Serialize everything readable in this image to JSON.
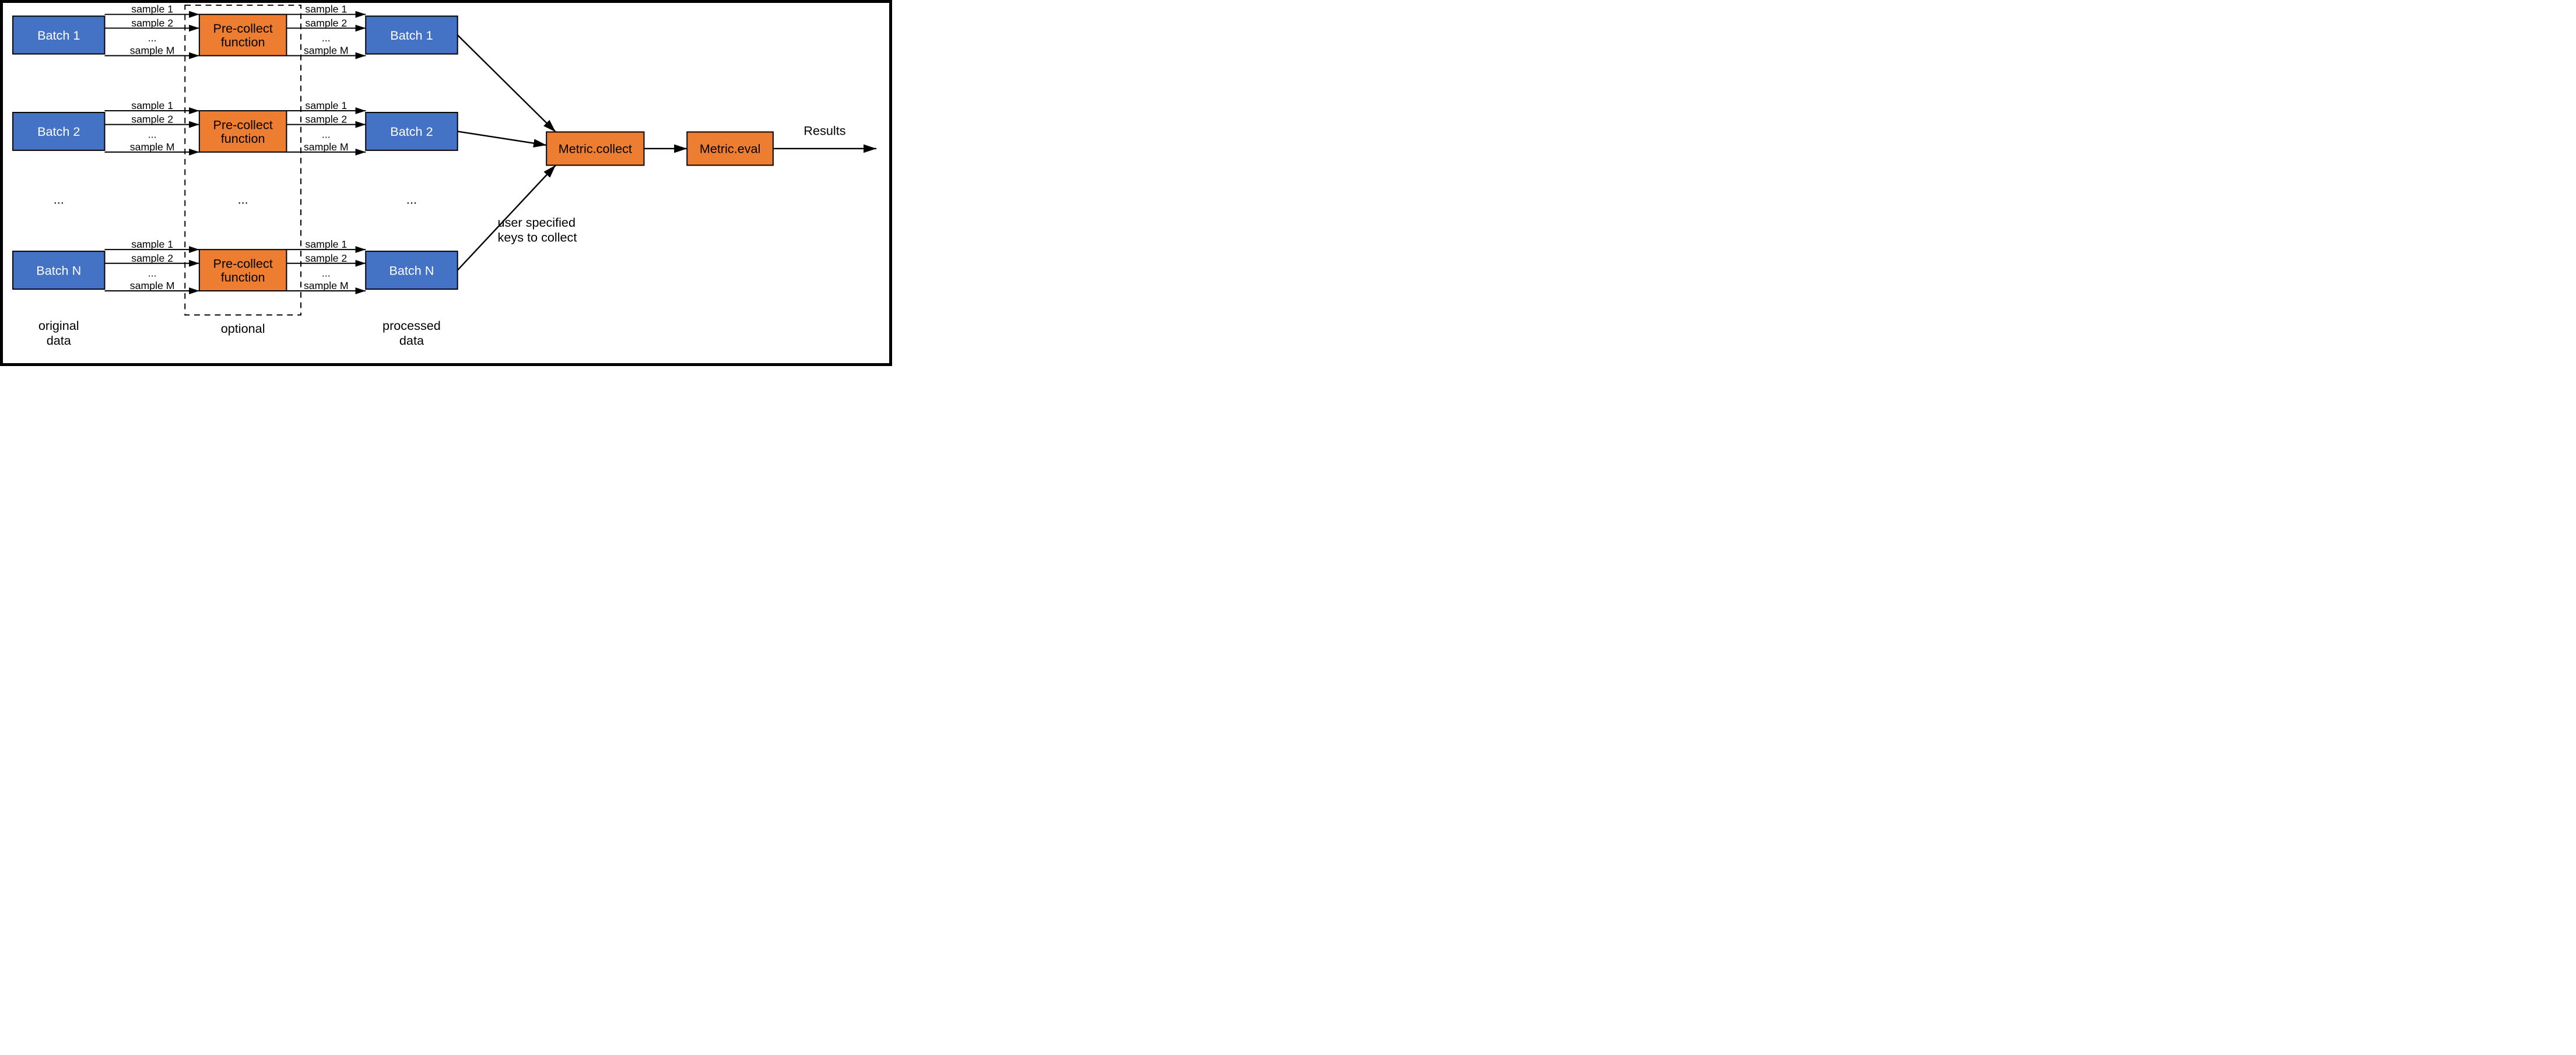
{
  "left_col": {
    "b1": "Batch 1",
    "b2": "Batch 2",
    "bn": "Batch N",
    "caption_l1": "original",
    "caption_l2": "data"
  },
  "pre": {
    "line1": "Pre-collect",
    "line2": "function",
    "caption": "optional"
  },
  "right_col": {
    "b1": "Batch 1",
    "b2": "Batch 2",
    "bn": "Batch N",
    "caption_l1": "processed",
    "caption_l2": "data"
  },
  "samples": {
    "s1": "sample 1",
    "s2": "sample 2",
    "dots": "...",
    "sm": "sample M"
  },
  "collect": "Metric.collect",
  "eval": "Metric.eval",
  "results": "Results",
  "note_l1": "user specified",
  "note_l2": "keys to collect",
  "ellipsis": "..."
}
